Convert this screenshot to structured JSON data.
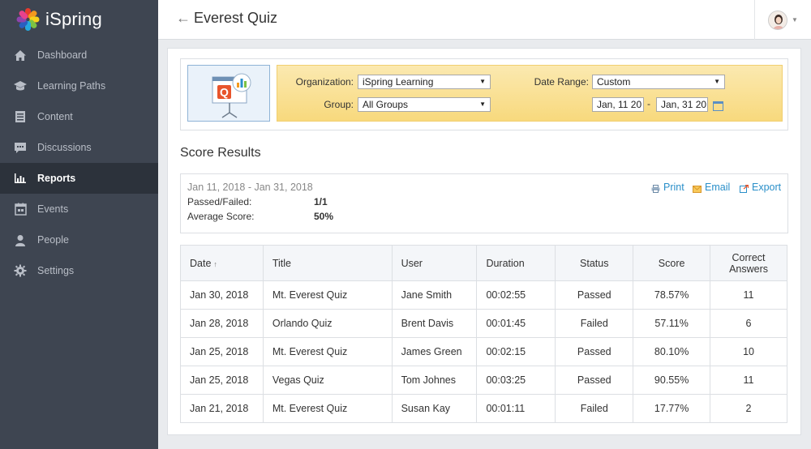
{
  "app": {
    "name": "iSpring"
  },
  "sidebar": {
    "items": [
      {
        "label": "Dashboard",
        "icon": "home-icon"
      },
      {
        "label": "Learning Paths",
        "icon": "graduation-cap-icon"
      },
      {
        "label": "Content",
        "icon": "document-icon"
      },
      {
        "label": "Discussions",
        "icon": "chat-icon"
      },
      {
        "label": "Reports",
        "icon": "bar-chart-icon",
        "active": true
      },
      {
        "label": "Events",
        "icon": "calendar-icon"
      },
      {
        "label": "People",
        "icon": "person-icon"
      },
      {
        "label": "Settings",
        "icon": "gear-icon"
      }
    ]
  },
  "header": {
    "back_icon": "←",
    "title": "Everest Quiz"
  },
  "filters": {
    "organization_label": "Organization:",
    "organization_value": "iSpring Learning",
    "group_label": "Group:",
    "group_value": "All Groups",
    "date_range_label": "Date Range:",
    "date_range_value": "Custom",
    "date_from": "Jan, 11 20",
    "date_sep": "-",
    "date_to": "Jan, 31 20"
  },
  "section_title": "Score Results",
  "summary": {
    "range": "Jan 11, 2018 - Jan 31, 2018",
    "passed_failed_label": "Passed/Failed:",
    "passed_failed_value": "1/1",
    "avg_score_label": "Average Score:",
    "avg_score_value": "50%",
    "print_label": "Print",
    "email_label": "Email",
    "export_label": "Export"
  },
  "table": {
    "headers": {
      "date": "Date",
      "title": "Title",
      "user": "User",
      "duration": "Duration",
      "status": "Status",
      "score": "Score",
      "correct_line1": "Correct",
      "correct_line2": "Answers"
    },
    "rows": [
      {
        "date": "Jan 30, 2018",
        "title": "Mt. Everest Quiz",
        "user": "Jane Smith",
        "duration": "00:02:55",
        "status": "Passed",
        "score": "78.57%",
        "correct": "11"
      },
      {
        "date": "Jan 28, 2018",
        "title": "Orlando Quiz",
        "user": "Brent Davis",
        "duration": "00:01:45",
        "status": "Failed",
        "score": "57.11%",
        "correct": "6"
      },
      {
        "date": "Jan 25, 2018",
        "title": "Mt. Everest Quiz",
        "user": "James Green",
        "duration": "00:02:15",
        "status": "Passed",
        "score": "80.10%",
        "correct": "10"
      },
      {
        "date": "Jan 25, 2018",
        "title": "Vegas Quiz",
        "user": "Tom Johnes",
        "duration": "00:03:25",
        "status": "Passed",
        "score": "90.55%",
        "correct": "11"
      },
      {
        "date": "Jan 21, 2018",
        "title": "Mt. Everest Quiz",
        "user": "Susan Kay",
        "duration": "00:01:11",
        "status": "Failed",
        "score": "17.77%",
        "correct": "2"
      }
    ]
  },
  "colors": {
    "sidebar_bg": "#3e4551",
    "sidebar_active": "#2c323b",
    "accent_blue": "#2a8fc9",
    "passed": "#3fa532",
    "failed": "#d0591e",
    "filter_bg": "#f8d97d"
  }
}
